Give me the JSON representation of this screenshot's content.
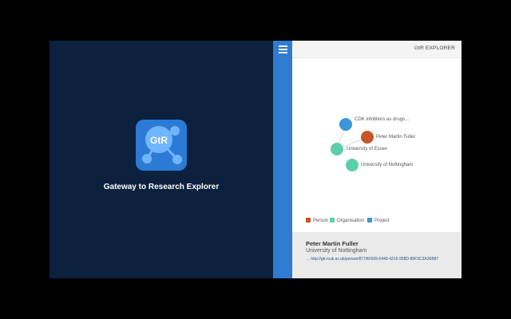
{
  "splash": {
    "logo_text": "GtR",
    "title": "Gateway to Research Explorer",
    "logo_color": "#2b7bd6",
    "background_color": "#0b213d"
  },
  "sidebar_strip": {
    "color": "#2e7bd1",
    "menu_icon": "hamburger-icon"
  },
  "panel": {
    "title": "GtR EXPLORER"
  },
  "graph": {
    "nodes": [
      {
        "id": "project",
        "label": "CDK inhibitors as drugs...",
        "type": "Project",
        "color": "#3b97d8"
      },
      {
        "id": "person",
        "label": "Peter Martin Fuller",
        "type": "Person",
        "color": "#c8552a"
      },
      {
        "id": "org-essex",
        "label": "University of Essex",
        "type": "Organisation",
        "color": "#5dcfa8"
      },
      {
        "id": "org-nottingham",
        "label": "University of Nottingham",
        "type": "Organisation",
        "color": "#5dcfa8"
      }
    ],
    "edges": [
      {
        "from": "project",
        "to": "org-essex"
      },
      {
        "from": "person",
        "to": "org-essex"
      }
    ]
  },
  "legend": [
    {
      "label": "Person",
      "color": "#c8552a"
    },
    {
      "label": "Organisation",
      "color": "#5dcfa8"
    },
    {
      "label": "Project",
      "color": "#3b97d8"
    }
  ],
  "details": {
    "name": "Peter Martin Fuller",
    "organisation": "University of Nottingham",
    "link": "→ http://gtr.rcuk.ac.uk/person/877AF669-6449-4215-958D-89F3C2A36B87"
  }
}
